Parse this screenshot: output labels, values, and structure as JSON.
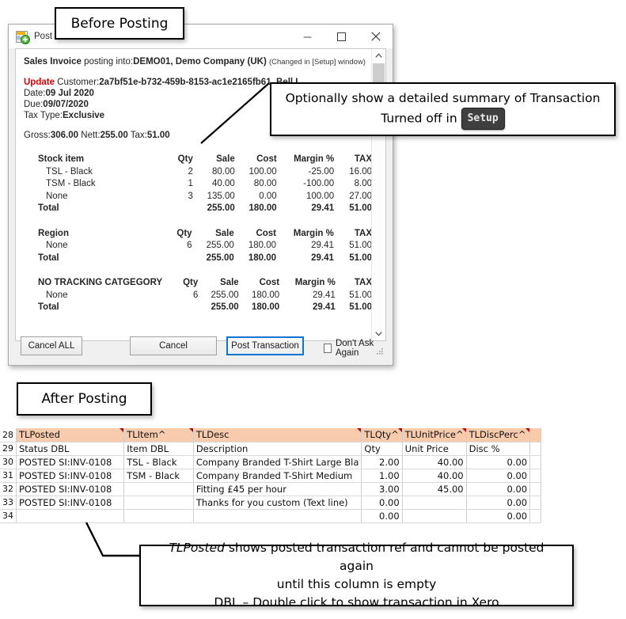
{
  "callouts": {
    "before_posting": "Before Posting",
    "after_posting": "After Posting",
    "optional_summary_line1": "Optionally show a detailed summary of Transaction",
    "optional_summary_line2_prefix": "Turned off in ",
    "optional_summary_kbd": "Setup",
    "bottom_line1_italic": "TLPosted",
    "bottom_line1_rest": " shows posted transaction ref and cannot be posted again",
    "bottom_line2": "until this column is empty",
    "bottom_line3": "DBL – Double click to show transaction in Xero"
  },
  "dialog": {
    "title": "Post No",
    "icon": "spreadsheet-post-icon",
    "window_buttons": {
      "minimize": "minimize-icon",
      "maximize": "maximize-icon",
      "close": "close-icon"
    },
    "header": {
      "doc_type": "Sales Invoice",
      "posting_into_label": " posting into:",
      "company": "DEMO01, Demo Company (UK)",
      "note": "(Changed in [Setup] window)"
    },
    "fields": {
      "update_label": "Update",
      "customer_label": " Customer:",
      "customer_value": "2a7bf51e-b732-459b-8153-ac1e2165fb61, Bell L",
      "date_label": "Date:",
      "date_value": "09 Jul 2020",
      "due_label": "Due:",
      "due_value": "09/07/2020",
      "tax_type_label": "Tax Type:",
      "tax_type_value": "Exclusive",
      "totals_line": "Gross:306.00 Nett:255.00 Tax:51.00",
      "gross_label": "Gross:",
      "gross_value": "306.00",
      "nett_label": "Nett:",
      "nett_value": "255.00",
      "tax_label": "Tax:",
      "tax_value": "51.00"
    },
    "tables": [
      {
        "name": "stock-item-summary",
        "headers": [
          "Stock item",
          "Qty",
          "Sale",
          "Cost",
          "Margin %",
          "TAX"
        ],
        "rows": [
          [
            "TSL - Black",
            "2",
            "80.00",
            "100.00",
            "-25.00",
            "16.00"
          ],
          [
            "TSM - Black",
            "1",
            "40.00",
            "80.00",
            "-100.00",
            "8.00"
          ],
          [
            "None",
            "3",
            "135.00",
            "0.00",
            "100.00",
            "27.00"
          ]
        ],
        "total": [
          "Total",
          "",
          "255.00",
          "180.00",
          "29.41",
          "51.00"
        ]
      },
      {
        "name": "region-summary",
        "headers": [
          "Region",
          "Qty",
          "Sale",
          "Cost",
          "Margin %",
          "TAX"
        ],
        "rows": [
          [
            "None",
            "6",
            "255.00",
            "180.00",
            "29.41",
            "51.00"
          ]
        ],
        "total": [
          "Total",
          "",
          "255.00",
          "180.00",
          "29.41",
          "51.00"
        ]
      },
      {
        "name": "no-tracking-category-summary",
        "headers": [
          "NO TRACKING CATGEGORY",
          "Qty",
          "Sale",
          "Cost",
          "Margin %",
          "TAX"
        ],
        "rows": [
          [
            "None",
            "6",
            "255.00",
            "180.00",
            "29.41",
            "51.00"
          ]
        ],
        "total": [
          "Total",
          "",
          "255.00",
          "180.00",
          "29.41",
          "51.00"
        ]
      }
    ],
    "footer": {
      "cancel_all": "Cancel ALL",
      "cancel": "Cancel",
      "post_transaction": "Post Transaction",
      "dont_ask_again": "Don't Ask Again",
      "dont_ask_checked": false
    },
    "accent_color": "#0a76d2"
  },
  "spreadsheet": {
    "header_fill": "#F8CBAD",
    "row_numbers": [
      "28",
      "29",
      "30",
      "31",
      "32",
      "33",
      "34"
    ],
    "field_headers": [
      "TLPosted",
      "TLItem^",
      "TLDesc",
      "TLQty^",
      "TLUnitPrice^",
      "TLDiscPerc^"
    ],
    "friendly_headers": [
      "Status DBL",
      "Item DBL",
      "Description",
      "Qty",
      "Unit Price",
      "Disc %"
    ],
    "rows": [
      {
        "posted": "POSTED SI:INV-0108",
        "item": "TSL - Black",
        "desc": "Company Branded T-Shirt Large Bla",
        "qty": "2.00",
        "unit_price": "40.00",
        "disc": "0.00"
      },
      {
        "posted": "POSTED SI:INV-0108",
        "item": "TSM - Black",
        "desc": "Company Branded T-Shirt Medium",
        "qty": "1.00",
        "unit_price": "40.00",
        "disc": "0.00"
      },
      {
        "posted": "POSTED SI:INV-0108",
        "item": "",
        "desc": "Fitting £45 per hour",
        "qty": "3.00",
        "unit_price": "45.00",
        "disc": "0.00"
      },
      {
        "posted": "POSTED SI:INV-0108",
        "item": "",
        "desc": "Thanks for you custom (Text line)",
        "qty": "0.00",
        "unit_price": "",
        "disc": "0.00"
      },
      {
        "posted": "",
        "item": "",
        "desc": "",
        "qty": "0.00",
        "unit_price": "",
        "disc": "0.00"
      }
    ]
  }
}
